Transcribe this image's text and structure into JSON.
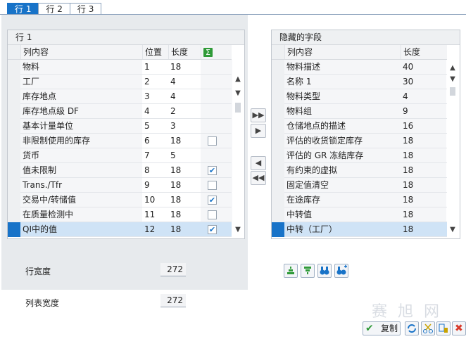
{
  "tabs": [
    {
      "label": "行 1",
      "active": true
    },
    {
      "label": "行 2",
      "active": false
    },
    {
      "label": "行 3",
      "active": false
    }
  ],
  "left_table": {
    "title": "行 1",
    "columns": [
      "列内容",
      "位置",
      "长度"
    ],
    "sum_icon": "sigma-icon",
    "rows": [
      {
        "content": "物料",
        "pos": "1",
        "len": "18",
        "check": null
      },
      {
        "content": "工厂",
        "pos": "2",
        "len": "4",
        "check": null
      },
      {
        "content": "库存地点",
        "pos": "3",
        "len": "4",
        "check": null
      },
      {
        "content": "库存地点级 DF",
        "pos": "4",
        "len": "2",
        "check": null
      },
      {
        "content": "基本计量单位",
        "pos": "5",
        "len": "3",
        "check": null
      },
      {
        "content": "非限制使用的库存",
        "pos": "6",
        "len": "18",
        "check": false
      },
      {
        "content": "货币",
        "pos": "7",
        "len": "5",
        "check": null
      },
      {
        "content": "值未限制",
        "pos": "8",
        "len": "18",
        "check": true
      },
      {
        "content": "Trans./Tfr",
        "pos": "9",
        "len": "18",
        "check": false
      },
      {
        "content": "交易中/转储值",
        "pos": "10",
        "len": "18",
        "check": true
      },
      {
        "content": "在质量检测中",
        "pos": "11",
        "len": "18",
        "check": false
      },
      {
        "content": "QI中的值",
        "pos": "12",
        "len": "18",
        "check": true,
        "selected": true
      }
    ]
  },
  "right_table": {
    "title": "隐藏的字段",
    "columns": [
      "列内容",
      "长度"
    ],
    "rows": [
      {
        "content": "物料描述",
        "len": "40"
      },
      {
        "content": "名称 1",
        "len": "30"
      },
      {
        "content": "物料类型",
        "len": "4"
      },
      {
        "content": "物料组",
        "len": "9"
      },
      {
        "content": "仓储地点的描述",
        "len": "16"
      },
      {
        "content": "评估的收货锁定库存",
        "len": "18"
      },
      {
        "content": "评估的 GR 冻结库存",
        "len": "18"
      },
      {
        "content": "有约束的虚拟",
        "len": "18"
      },
      {
        "content": "固定值清空",
        "len": "18"
      },
      {
        "content": "在途库存",
        "len": "18"
      },
      {
        "content": "中转值",
        "len": "18"
      },
      {
        "content": "中转（工厂）",
        "len": "18",
        "selected": true
      }
    ]
  },
  "row_width": {
    "label": "行宽度",
    "value": "272"
  },
  "list_width": {
    "label": "列表宽度",
    "value": "272"
  },
  "footer": {
    "copy_label": "复制"
  },
  "watermark": "赛 旭 网",
  "colors": {
    "accent": "#1873c8",
    "selected_row": "#cfe3f6",
    "cancel": "#d83b2b",
    "confirm": "#2f9a38"
  }
}
